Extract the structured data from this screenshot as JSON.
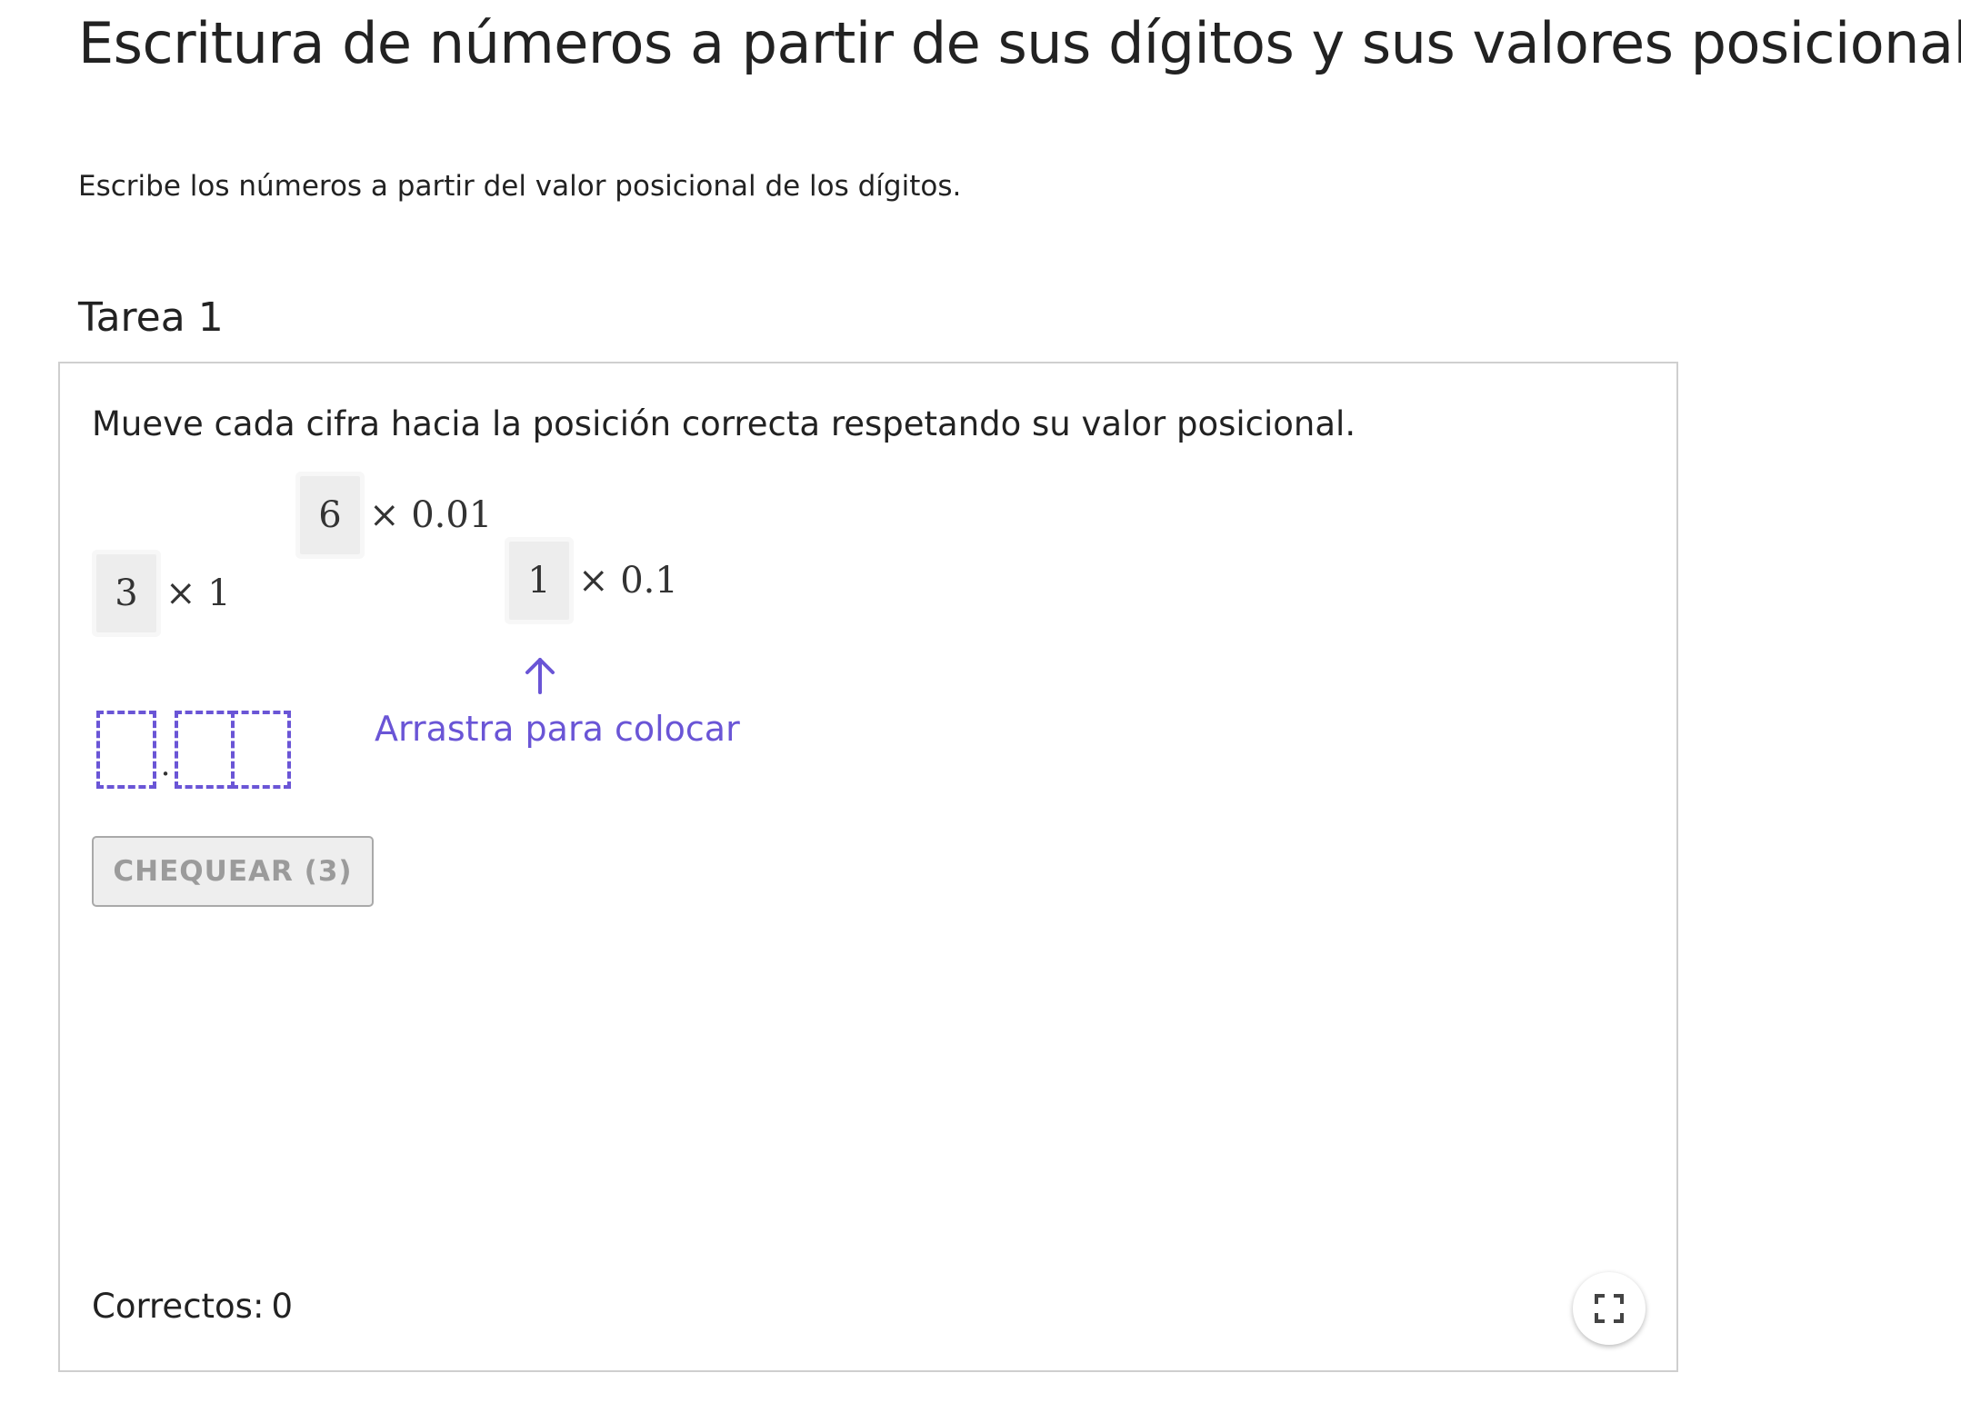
{
  "page": {
    "title": "Escritura de números a partir de sus dígitos y sus valores posicionales",
    "instruction": "Escribe los números a partir del valor posicional de los dígitos."
  },
  "task": {
    "title": "Tarea 1",
    "prompt": "Mueve cada cifra hacia la posición correcta respetando su valor posicional.",
    "tiles": [
      {
        "digit": "6",
        "multiplier": "× 0.01"
      },
      {
        "digit": "3",
        "multiplier": "× 1"
      },
      {
        "digit": "1",
        "multiplier": "× 0.1"
      }
    ],
    "answer": {
      "slots_before_point": 1,
      "slots_after_point": 2,
      "decimal_point": "."
    },
    "drag_hint": "Arrastra para colocar",
    "check_button_label": "CHEQUEAR (3)",
    "score_label": "Correctos:",
    "score_value": "0"
  },
  "icons": {
    "drag_arrow": "arrow-up-icon",
    "fullscreen": "fullscreen-icon"
  },
  "colors": {
    "accent": "#6a55d6",
    "tile_background": "#ededed",
    "button_disabled_text": "#9b9b9b"
  }
}
